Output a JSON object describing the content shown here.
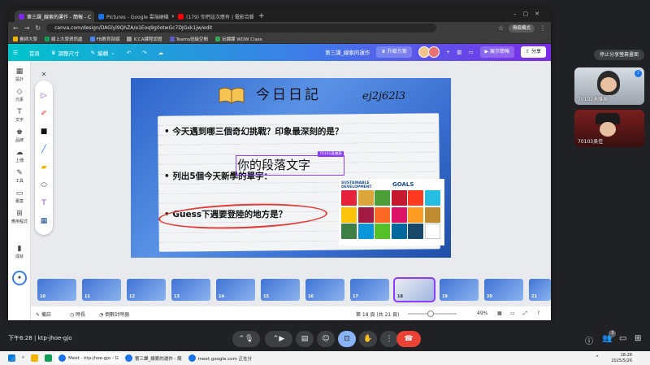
{
  "chrome": {
    "tabs": [
      {
        "title": "第三課_線索的運作 - 簡報 - C",
        "active": true,
        "color": "#7d2ae8"
      },
      {
        "title": "Pictures - Google 雲端硬碟",
        "active": false,
        "color": "#1a73e8"
      },
      {
        "title": "(179) 你們這次應有 | 電影合輯",
        "active": false,
        "color": "#ff0000"
      }
    ],
    "url": "canva.com/design/DAGlyl9QhZA/e1Eoq9g0otwGc7DJGxk1jw/edit",
    "guest_label": "無痕模式",
    "bookmarks": [
      "臺師大學",
      "線上大學資訊處",
      "FB教育部媒",
      "ICCA課程認證",
      "Teams班級空間",
      "玩課課 WOW Class"
    ]
  },
  "canva": {
    "home": "首頁",
    "resize": "調整尺寸",
    "edit": "編輯",
    "doc_title": "第三課_線索的運作",
    "upgrade": "升級方案",
    "present": "展示簡報",
    "share": "分享",
    "sidebar": [
      "設計",
      "元素",
      "文字",
      "品牌",
      "上傳",
      "工具",
      "專案",
      "應用程式",
      "成就"
    ],
    "tools": [
      "select",
      "pen",
      "marker",
      "highlighter",
      "eraser",
      "shape",
      "text",
      "table"
    ],
    "slide": {
      "title": "今日日記",
      "handwriting": "ej2j62l3",
      "bullets": [
        "今天遇到哪三個奇幻挑戰？印象最深刻的是？",
        "列出5個今天新學的單字：",
        "Guess下週要登陸的地方是？"
      ],
      "textbox": "你的段落文字",
      "textbox_tag": "70102吳維辰",
      "sdg_title_1": "SUSTAINABLE",
      "sdg_title_2": "DEVELOPMENT",
      "sdg_goals": "GOALS"
    },
    "thumbs": [
      "10",
      "11",
      "12",
      "13",
      "14",
      "15",
      "16",
      "17",
      "18",
      "19",
      "20",
      "21"
    ],
    "selected_thumb": "18",
    "footer": {
      "notes": "備註",
      "duration": "時長",
      "timer": "倒數計時器",
      "page": "第 18 頁 (共 21 頁)",
      "zoom": "49%"
    }
  },
  "meet": {
    "share_pill": "停止分享螢幕畫面",
    "participants": [
      {
        "name": "70102吳維辰",
        "bg": "#c9ced6"
      },
      {
        "name": "70103吳佳"
      }
    ],
    "time": "下午6:28",
    "code": "ktp-jhoe-gjo",
    "people_count": "3"
  },
  "taskbar": {
    "apps": [
      "Meet - ktp-jhoe-gjo - G",
      "第三課_線索的運作 - 簡",
      "meet.google.com 正在分"
    ],
    "time": "18:28",
    "date": "2025/5/26"
  },
  "colors": {
    "canva_gradient_start": "#00c4cc",
    "canva_gradient_end": "#7d2ae8",
    "selection": "#8b3dff",
    "end_call": "#ea4335",
    "meet_active": "#8ab4f8"
  }
}
